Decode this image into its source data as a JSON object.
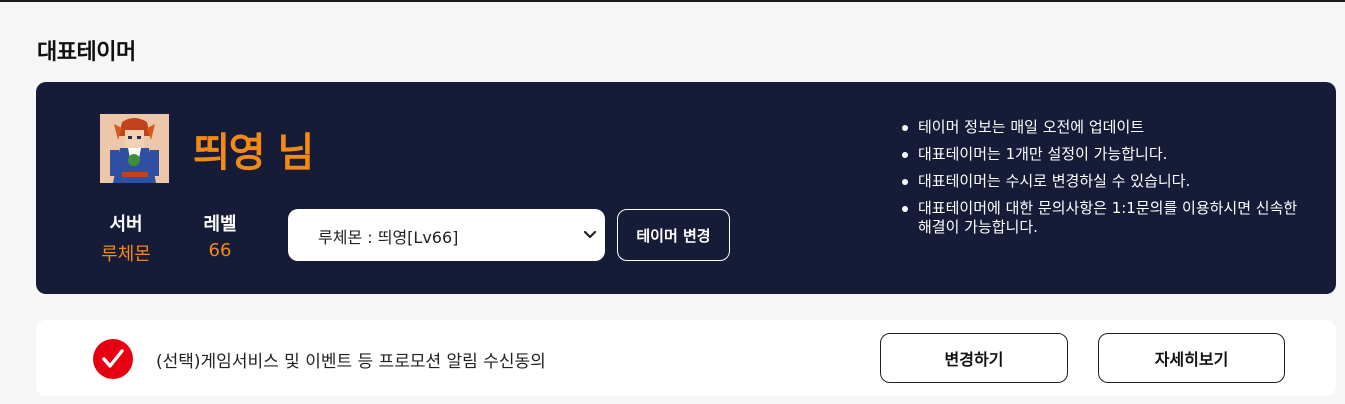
{
  "section_title": "대표테이머",
  "profile": {
    "name": "띄영 님",
    "server_label": "서버",
    "server_value": "루체몬",
    "level_label": "레벨",
    "level_value": "66"
  },
  "tamer_select": {
    "selected": "루체몬 : 띄영[Lv66]"
  },
  "change_tamer_label": "테이머 변경",
  "notices": [
    "테이머 정보는 매일 오전에 업데이트",
    "대표테이머는 1개만 설정이 가능합니다.",
    "대표테이머는 수시로 변경하실 수 있습니다.",
    "대표테이머에 대한 문의사항은 1:1문의를 이용하시면 신속한 해결이 가능합니다."
  ],
  "consent": {
    "text": "(선택)게임서비스 및 이벤트 등 프로모션 알림 수신동의",
    "change_label": "변경하기",
    "detail_label": "자세히보기"
  },
  "colors": {
    "card_bg": "#161b38",
    "accent_orange": "#f28a16",
    "check_red": "#e60012"
  },
  "icons": {
    "dropdown": "chevron-down-icon",
    "consent": "check-circle-icon"
  }
}
